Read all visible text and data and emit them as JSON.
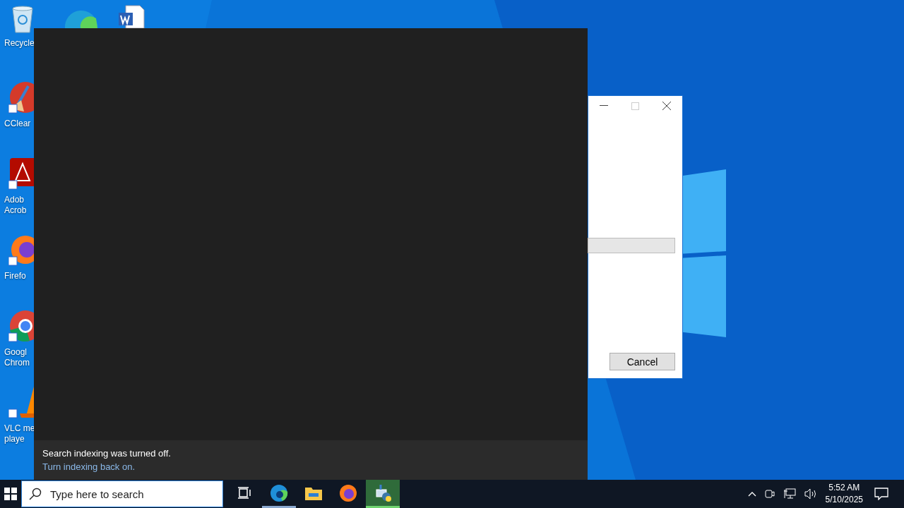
{
  "desktop_icons": [
    {
      "kind": "recycle",
      "lines": [
        "Recycle"
      ]
    },
    {
      "kind": "edge"
    },
    {
      "kind": "word"
    },
    {
      "kind": "ccleaner",
      "lines": [
        "CClear"
      ]
    },
    {
      "kind": "acrobat",
      "lines": [
        "Adob",
        "Acrob"
      ]
    },
    {
      "kind": "firefox",
      "lines": [
        "Firefo"
      ]
    },
    {
      "kind": "chrome",
      "lines": [
        "Googl",
        "Chrom"
      ]
    },
    {
      "kind": "vlc",
      "lines": [
        "VLC me",
        "playe"
      ]
    }
  ],
  "dialog": {
    "cancel_button": "Cancel"
  },
  "search_panel": {
    "notice": "Search indexing was turned off.",
    "link": "Turn indexing back on."
  },
  "taskbar": {
    "search": {
      "placeholder": "Type here to search"
    },
    "apps": [
      {
        "kind": "taskview",
        "running": false,
        "selected": false
      },
      {
        "kind": "edge",
        "running": true,
        "selected": false
      },
      {
        "kind": "explorer",
        "running": false,
        "selected": false
      },
      {
        "kind": "firefox",
        "running": false,
        "selected": false
      },
      {
        "kind": "python",
        "running": true,
        "selected": true
      }
    ],
    "clock": {
      "time": "5:52 AM",
      "date": "5/10/2025"
    }
  }
}
